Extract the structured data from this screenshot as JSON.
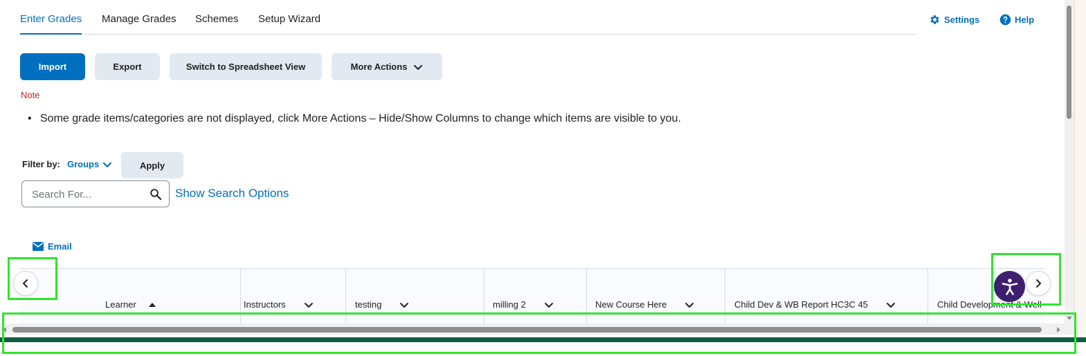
{
  "nav": {
    "tabs": [
      {
        "label": "Enter Grades",
        "active": true
      },
      {
        "label": "Manage Grades",
        "active": false
      },
      {
        "label": "Schemes",
        "active": false
      },
      {
        "label": "Setup Wizard",
        "active": false
      }
    ],
    "settings_label": "Settings",
    "help_label": "Help"
  },
  "toolbar": {
    "import_label": "Import",
    "export_label": "Export",
    "spreadsheet_label": "Switch to Spreadsheet View",
    "more_actions_label": "More Actions"
  },
  "note": {
    "title": "Note",
    "message": "Some grade items/categories are not displayed, click More Actions – Hide/Show Columns to change which items are visible to you."
  },
  "filter": {
    "label": "Filter by:",
    "groups_label": "Groups",
    "apply_label": "Apply"
  },
  "search": {
    "placeholder": "Search For...",
    "show_options_label": "Show Search Options"
  },
  "email_label": "Email",
  "grid": {
    "columns": [
      {
        "title": "Learner",
        "sort": "asc"
      },
      {
        "title": "Instructors"
      },
      {
        "title": "testing"
      },
      {
        "title": "milling 2"
      },
      {
        "title": "New Course Here"
      },
      {
        "title": "Child Dev & WB Report HC3C 45"
      },
      {
        "title": "Child Development & Well"
      }
    ]
  },
  "icons": {
    "settings": "gear-icon",
    "help": "help-circle-icon",
    "dropdown": "chevron-down-icon",
    "search": "magnifier-icon",
    "email": "envelope-icon",
    "scroll_left": "chevron-left-icon",
    "scroll_right": "chevron-right-icon",
    "accessibility": "accessibility-person-icon"
  },
  "colors": {
    "primary": "#006fbf",
    "note_red": "#cd2026",
    "secondary_button": "#e3e9f1",
    "footer_bar": "#0d5c3f",
    "accessibility_purple": "#3d1f6e",
    "highlight": "#2ee52e"
  }
}
